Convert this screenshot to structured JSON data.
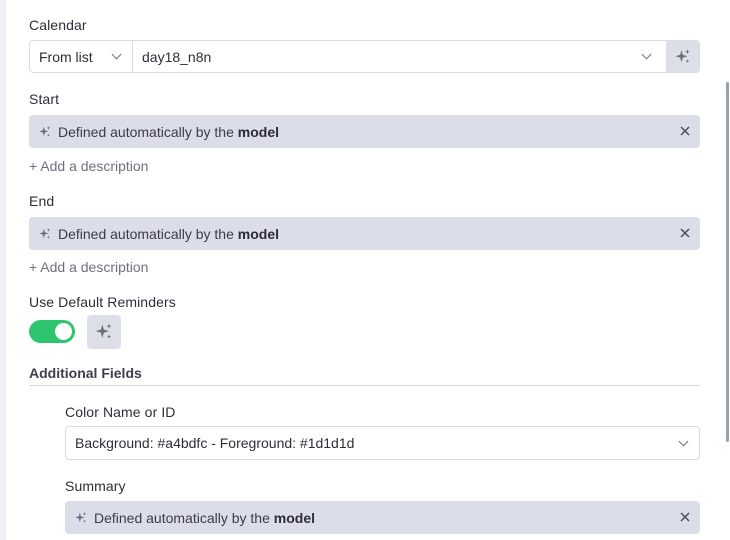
{
  "calendar": {
    "label": "Calendar",
    "mode": "From list",
    "value": "day18_n8n"
  },
  "start": {
    "label": "Start",
    "pill_prefix": "Defined automatically by the ",
    "pill_bold": "model",
    "add_description": "+ Add a description"
  },
  "end": {
    "label": "End",
    "pill_prefix": "Defined automatically by the ",
    "pill_bold": "model",
    "add_description": "+ Add a description"
  },
  "reminders": {
    "label": "Use Default Reminders",
    "enabled": true
  },
  "additional_fields": {
    "title": "Additional Fields",
    "color": {
      "label": "Color Name or ID",
      "value": "Background: #a4bdfc - Foreground: #1d1d1d"
    },
    "summary": {
      "label": "Summary",
      "pill_prefix": "Defined automatically by the ",
      "pill_bold": "model"
    }
  },
  "icons": {
    "sparkle": "sparkles-icon",
    "close": "close-icon",
    "chevron": "chevron-down-icon"
  },
  "colors": {
    "toggle_on": "#2dc66e",
    "pill_bg": "#dbdee8"
  }
}
